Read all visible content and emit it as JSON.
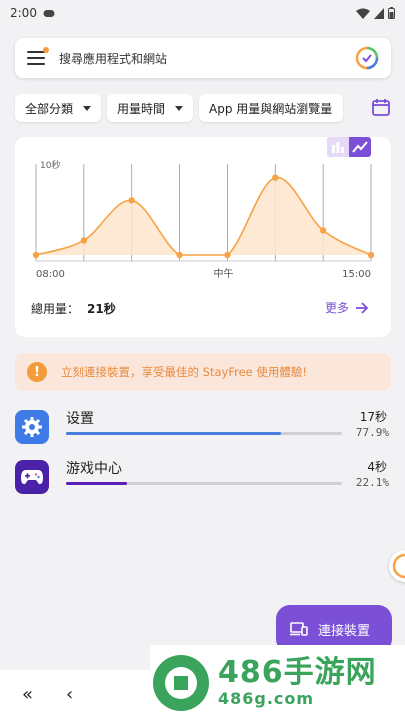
{
  "status_bar": {
    "time": "2:00"
  },
  "search": {
    "placeholder": "搜尋應用程式和網站"
  },
  "filters": [
    {
      "label": "全部分類"
    },
    {
      "label": "用量時間"
    },
    {
      "label": "App 用量與網站瀏覽量"
    }
  ],
  "chart_data": {
    "type": "area",
    "ylabel_tick": "10秒",
    "x_tick_labels": [
      "08:00",
      "中午",
      "15:00"
    ],
    "x": [
      0,
      1,
      2,
      3,
      4,
      5,
      6,
      7
    ],
    "values": [
      0,
      1.6,
      6.0,
      0,
      0,
      8.5,
      2.7,
      0
    ],
    "ylim": [
      0,
      10
    ],
    "grid": true,
    "colors": {
      "line": "#f7a246",
      "fill": "#fde5cc"
    }
  },
  "summary": {
    "total_label": "總用量：",
    "total_value": "21秒",
    "more_label": "更多"
  },
  "promo": {
    "text": "立刻連接裝置，享受最佳的 StayFree 使用體驗!"
  },
  "apps": [
    {
      "name": "设置",
      "time": "17秒",
      "percent": "77.9%",
      "fraction": 0.779,
      "bar_color": "#4a7de0",
      "icon": "gear-icon"
    },
    {
      "name": "游戏中心",
      "time": "4秒",
      "percent": "22.1%",
      "fraction": 0.221,
      "bar_color": "#5a1fb5",
      "icon": "gamepad-icon"
    }
  ],
  "fab": {
    "label": "連接裝置"
  },
  "watermark": {
    "big": "486手游网",
    "small": "486g.com"
  },
  "colors": {
    "accent": "#7b4fd6",
    "warning": "#f39c3c"
  }
}
